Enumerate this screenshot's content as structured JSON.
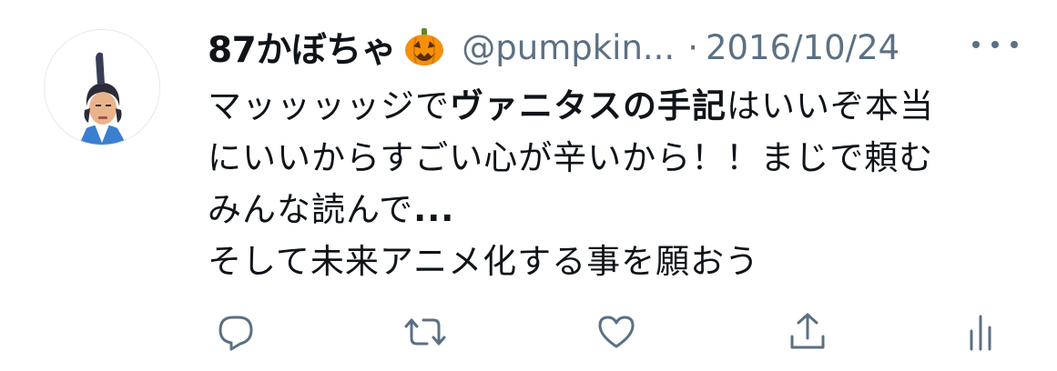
{
  "user": {
    "display_name": "87かぼちゃ",
    "badge_emoji": "jack-o-lantern",
    "handle": "@pumpkin...",
    "separator": "·",
    "date": "2016/10/24"
  },
  "tweet": {
    "line1_a": "マッッッッジで",
    "line1_bold": "ヴァニタスの手記",
    "line1_b": "はいいぞ本当",
    "line2": "にいいからすごい心が辛いから！！まじで頼む",
    "line3_a": "みんな読んで",
    "line3_bold": "...",
    "line4": "そして未来アニメ化する事を願おう"
  },
  "actions": [
    "reply-icon",
    "retweet-icon",
    "like-icon",
    "share-icon",
    "analytics-icon"
  ],
  "colors": {
    "text": "#0f1419",
    "secondary": "#5b7083",
    "pumpkin": "#f4900c"
  }
}
